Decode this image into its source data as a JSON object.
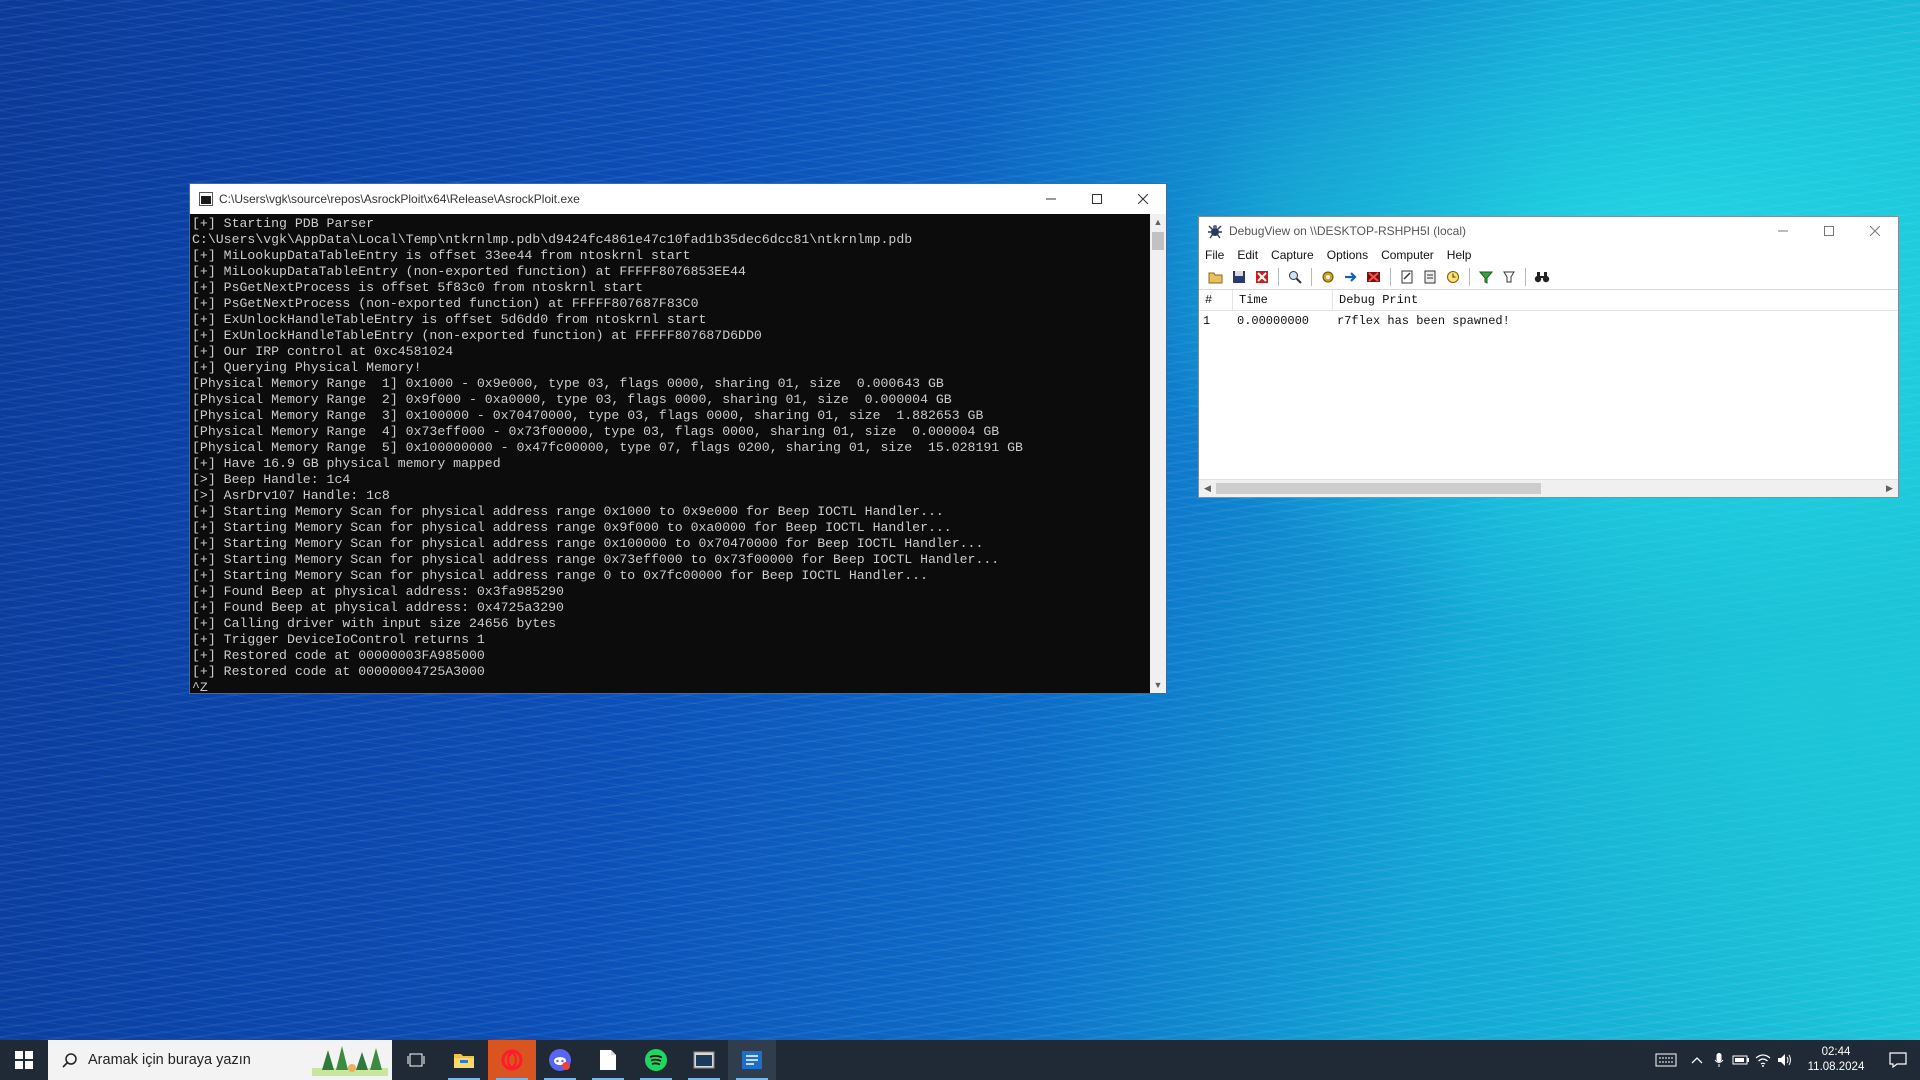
{
  "console": {
    "title": "C:\\Users\\vgk\\source\\repos\\AsrockPloit\\x64\\Release\\AsrockPloit.exe",
    "lines": [
      "[+] Starting PDB Parser",
      "C:\\Users\\vgk\\AppData\\Local\\Temp\\ntkrnlmp.pdb\\d9424fc4861e47c10fad1b35dec6dcc81\\ntkrnlmp.pdb",
      "[+] MiLookupDataTableEntry is offset 33ee44 from ntoskrnl start",
      "[+] MiLookupDataTableEntry (non-exported function) at FFFFF8076853EE44",
      "[+] PsGetNextProcess is offset 5f83c0 from ntoskrnl start",
      "[+] PsGetNextProcess (non-exported function) at FFFFF807687F83C0",
      "[+] ExUnlockHandleTableEntry is offset 5d6dd0 from ntoskrnl start",
      "[+] ExUnlockHandleTableEntry (non-exported function) at FFFFF807687D6DD0",
      "[+] Our IRP control at 0xc4581024",
      "[+] Querying Physical Memory!",
      "[Physical Memory Range  1] 0x1000 - 0x9e000, type 03, flags 0000, sharing 01, size  0.000643 GB",
      "[Physical Memory Range  2] 0x9f000 - 0xa0000, type 03, flags 0000, sharing 01, size  0.000004 GB",
      "[Physical Memory Range  3] 0x100000 - 0x70470000, type 03, flags 0000, sharing 01, size  1.882653 GB",
      "[Physical Memory Range  4] 0x73eff000 - 0x73f00000, type 03, flags 0000, sharing 01, size  0.000004 GB",
      "[Physical Memory Range  5] 0x100000000 - 0x47fc00000, type 07, flags 0200, sharing 01, size  15.028191 GB",
      "[+] Have 16.9 GB physical memory mapped",
      "[>] Beep Handle: 1c4",
      "[>] AsrDrv107 Handle: 1c8",
      "[+] Starting Memory Scan for physical address range 0x1000 to 0x9e000 for Beep IOCTL Handler...",
      "[+] Starting Memory Scan for physical address range 0x9f000 to 0xa0000 for Beep IOCTL Handler...",
      "[+] Starting Memory Scan for physical address range 0x100000 to 0x70470000 for Beep IOCTL Handler...",
      "[+] Starting Memory Scan for physical address range 0x73eff000 to 0x73f00000 for Beep IOCTL Handler...",
      "[+] Starting Memory Scan for physical address range 0 to 0x7fc00000 for Beep IOCTL Handler...",
      "[+] Found Beep at physical address: 0x3fa985290",
      "[+] Found Beep at physical address: 0x4725a3290",
      "[+] Calling driver with input size 24656 bytes",
      "[+] Trigger DeviceIoControl returns 1",
      "[+] Restored code at 00000003FA985000",
      "[+] Restored code at 00000004725A3000",
      "^Z"
    ]
  },
  "debugview": {
    "title": "DebugView on \\\\DESKTOP-RSHPH5I (local)",
    "menu": [
      "File",
      "Edit",
      "Capture",
      "Options",
      "Computer",
      "Help"
    ],
    "columns": [
      "#",
      "Time",
      "Debug Print"
    ],
    "rows": [
      {
        "num": "1",
        "time": "0.00000000",
        "text": "r7flex has been spawned!"
      }
    ]
  },
  "taskbar": {
    "search_placeholder": "Aramak için buraya yazın",
    "time": "02:44",
    "date": "11.08.2024"
  },
  "colors": {
    "console_bg": "#0c0c0c",
    "console_fg": "#cccccc",
    "taskbar_bg": "#1f2a36"
  }
}
